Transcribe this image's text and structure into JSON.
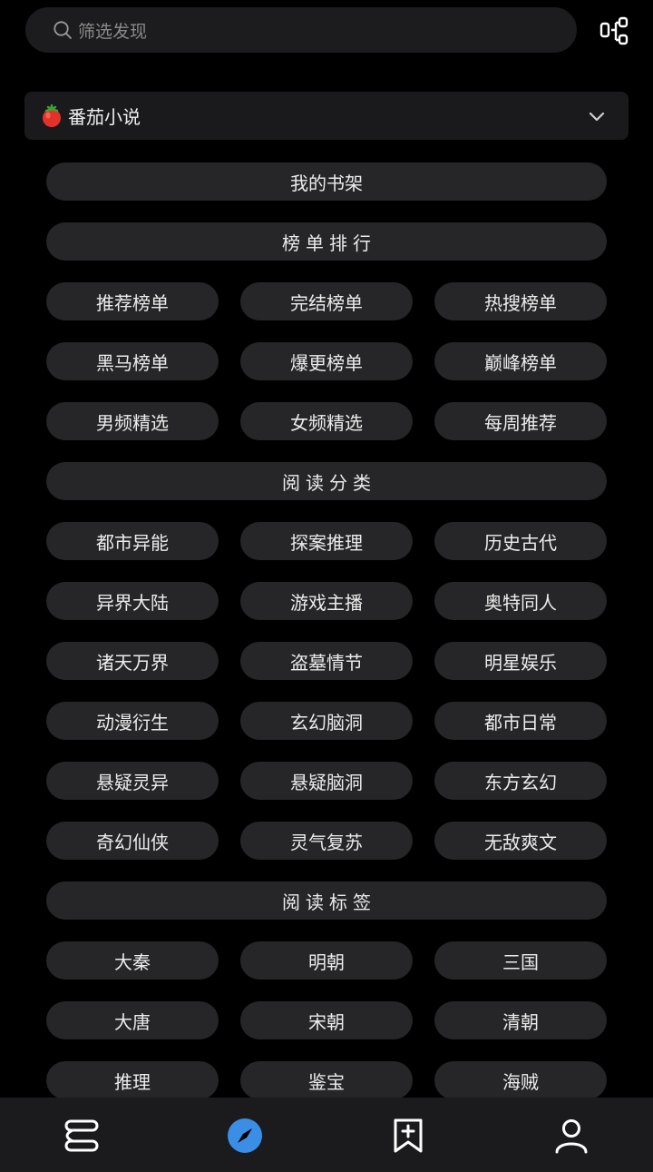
{
  "search": {
    "placeholder": "筛选发现"
  },
  "source": {
    "label": "番茄小说"
  },
  "sections": [
    {
      "title": "我的书架",
      "items": []
    },
    {
      "title": "榜单排行",
      "items": [
        "推荐榜单",
        "完结榜单",
        "热搜榜单",
        "黑马榜单",
        "爆更榜单",
        "巅峰榜单",
        "男频精选",
        "女频精选",
        "每周推荐"
      ]
    },
    {
      "title": "阅读分类",
      "items": [
        "都市异能",
        "探案推理",
        "历史古代",
        "异界大陆",
        "游戏主播",
        "奥特同人",
        "诸天万界",
        "盗墓情节",
        "明星娱乐",
        "动漫衍生",
        "玄幻脑洞",
        "都市日常",
        "悬疑灵异",
        "悬疑脑洞",
        "东方玄幻",
        "奇幻仙侠",
        "灵气复苏",
        "无敌爽文"
      ]
    },
    {
      "title": "阅读标签",
      "items": [
        "大秦",
        "明朝",
        "三国",
        "大唐",
        "宋朝",
        "清朝",
        "推理",
        "鉴宝",
        "海贼"
      ]
    }
  ],
  "nav": {
    "items": [
      {
        "icon": "bookshelf-icon",
        "active": false
      },
      {
        "icon": "compass-icon",
        "active": true
      },
      {
        "icon": "bookmark-add-icon",
        "active": false
      },
      {
        "icon": "profile-icon",
        "active": false
      }
    ]
  },
  "colors": {
    "accent": "#3a8ee6",
    "pill": "#262628",
    "background": "#000000"
  }
}
